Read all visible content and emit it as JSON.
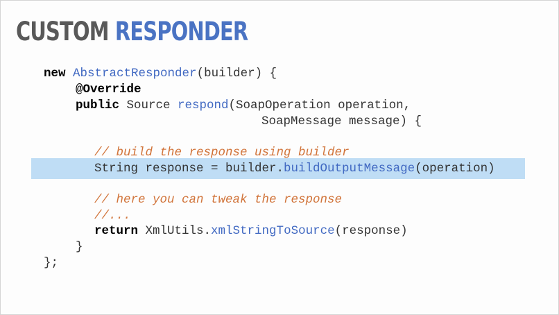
{
  "slide": {
    "title_part1": "CUSTOM",
    "title_part2": "RESPONDER"
  },
  "code": {
    "line1": {
      "kw": "new",
      "cls": "AbstractResponder",
      "rest": "(builder) {"
    },
    "line2": {
      "annotation": "@Override"
    },
    "line3": {
      "kw": "public",
      "type": " Source ",
      "method": "respond",
      "rest": "(SoapOperation operation,"
    },
    "line4": {
      "rest": "SoapMessage message) {"
    },
    "line5": {
      "comment": "// build the response using builder"
    },
    "line6": {
      "pre": "String response = builder.",
      "method": "buildOutputMessage",
      "rest": "(operation)"
    },
    "line7": {
      "comment": "// here you can tweak the response"
    },
    "line8": {
      "comment": "//..."
    },
    "line9": {
      "kw": "return",
      "pre": " XmlUtils.",
      "method": "xmlStringToSource",
      "rest": "(response)"
    },
    "line10": {
      "rest": "}"
    },
    "line11": {
      "rest": "};"
    }
  },
  "colors": {
    "title_gray": "#595959",
    "title_blue": "#4a73c3",
    "keyword": "#000000",
    "identifier_blue": "#4169c2",
    "comment_orange": "#d1743a",
    "highlight": "#bfddf5"
  }
}
